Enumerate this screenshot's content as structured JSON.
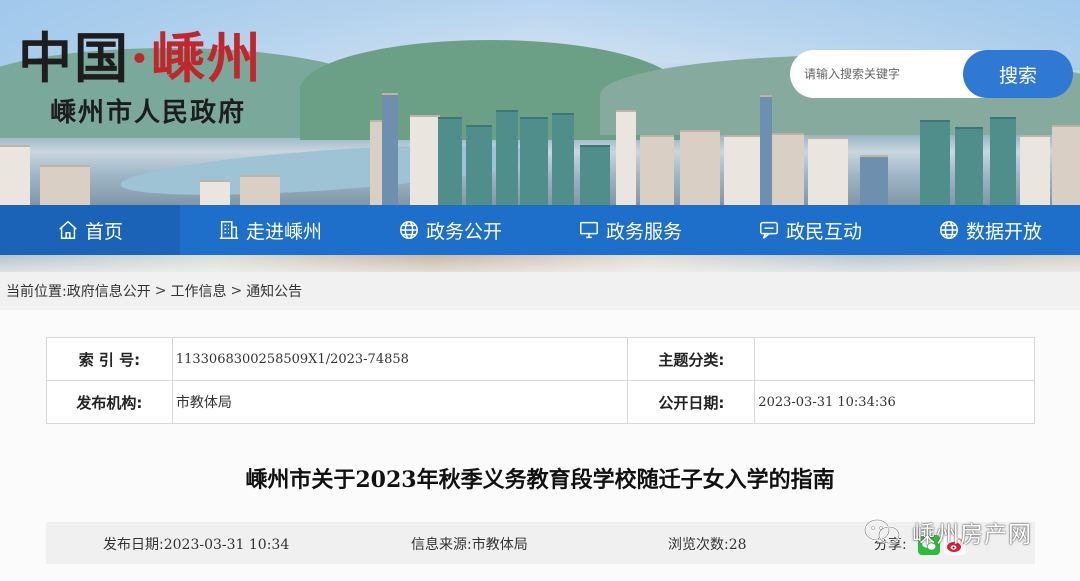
{
  "header": {
    "logo_country": "中国",
    "logo_dot": "·",
    "logo_city": "嵊州",
    "logo_subtitle": "嵊州市人民政府",
    "search_placeholder": "请输入搜索关键字",
    "search_button": "搜索"
  },
  "nav": {
    "items": [
      {
        "label": "首页",
        "icon": "home-icon"
      },
      {
        "label": "走进嵊州",
        "icon": "building-icon"
      },
      {
        "label": "政务公开",
        "icon": "globe-icon"
      },
      {
        "label": "政务服务",
        "icon": "monitor-icon"
      },
      {
        "label": "政民互动",
        "icon": "chat-icon"
      },
      {
        "label": "数据开放",
        "icon": "globe-icon"
      }
    ]
  },
  "breadcrumb": {
    "prefix": "当前位置:",
    "items": [
      "政府信息公开",
      "工作信息",
      "通知公告"
    ],
    "separator": ">"
  },
  "meta": {
    "index_label": "索 引 号:",
    "index_value": "1133068300258509X1/2023-74858",
    "topic_label": "主题分类:",
    "topic_value": "",
    "publisher_label": "发布机构:",
    "publisher_value": "市教体局",
    "open_date_label": "公开日期:",
    "open_date_value": "2023-03-31 10:34:36"
  },
  "article": {
    "title": "嵊州市关于2023年秋季义务教育段学校随迁子女入学的指南",
    "publish_date_label": "发布日期:",
    "publish_date_value": "2023-03-31 10:34",
    "source_label": "信息来源:",
    "source_value": "市教体局",
    "views_label": "浏览次数:",
    "views_value": "28",
    "share_label": "分享:"
  },
  "watermark": {
    "text": "嵊州房产网",
    "icon": "wechat-official-account-icon"
  },
  "colors": {
    "nav_bg": "#1e6fc9",
    "search_button_bg": "#2f78d3",
    "logo_red": "#c0272d"
  }
}
